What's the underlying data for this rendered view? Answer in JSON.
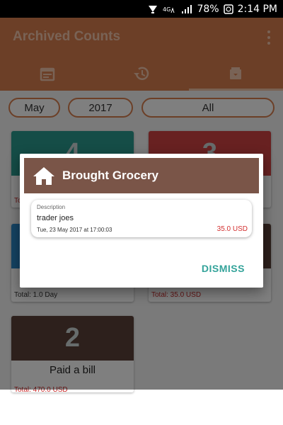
{
  "status_bar": {
    "battery": "78%",
    "time": "2:14 PM",
    "icons": [
      "cast-icon",
      "network-type-icon",
      "signal-icon",
      "alarm-icon"
    ]
  },
  "app_bar": {
    "title": "Archived Counts",
    "tabs": [
      {
        "icon": "calendar-icon",
        "active": false
      },
      {
        "icon": "history-icon",
        "active": false
      },
      {
        "icon": "archive-icon",
        "active": true
      }
    ]
  },
  "filters": {
    "month": "May",
    "year": "2017",
    "category": "All"
  },
  "cards": [
    {
      "count": "4",
      "color": "#2A9A8E",
      "name": "",
      "total": "Tot..."
    },
    {
      "count": "3",
      "color": "#D14343",
      "name": "",
      "total": ""
    },
    {
      "count": "",
      "color": "#2A86C7",
      "name": "",
      "total": "Total: 1.0 Day"
    },
    {
      "count": "",
      "color": "#5A4138",
      "name": "",
      "total": "Total: 35.0 USD"
    },
    {
      "count": "2",
      "color": "#5A4138",
      "name": "Paid a bill",
      "total": "Total: 470.0 USD"
    }
  ],
  "dialog": {
    "title": "Brought Grocery",
    "icon": "home-icon",
    "description_label": "Description",
    "description": "trader joes",
    "date": "Tue, 23 May 2017 at 17:00:03",
    "amount": "35.0 USD",
    "dismiss_label": "DISMISS"
  },
  "colors": {
    "primary": "#D87F4E",
    "dialog_header": "#7A5548",
    "accent": "#33A39A",
    "amount": "#D32F2F"
  }
}
